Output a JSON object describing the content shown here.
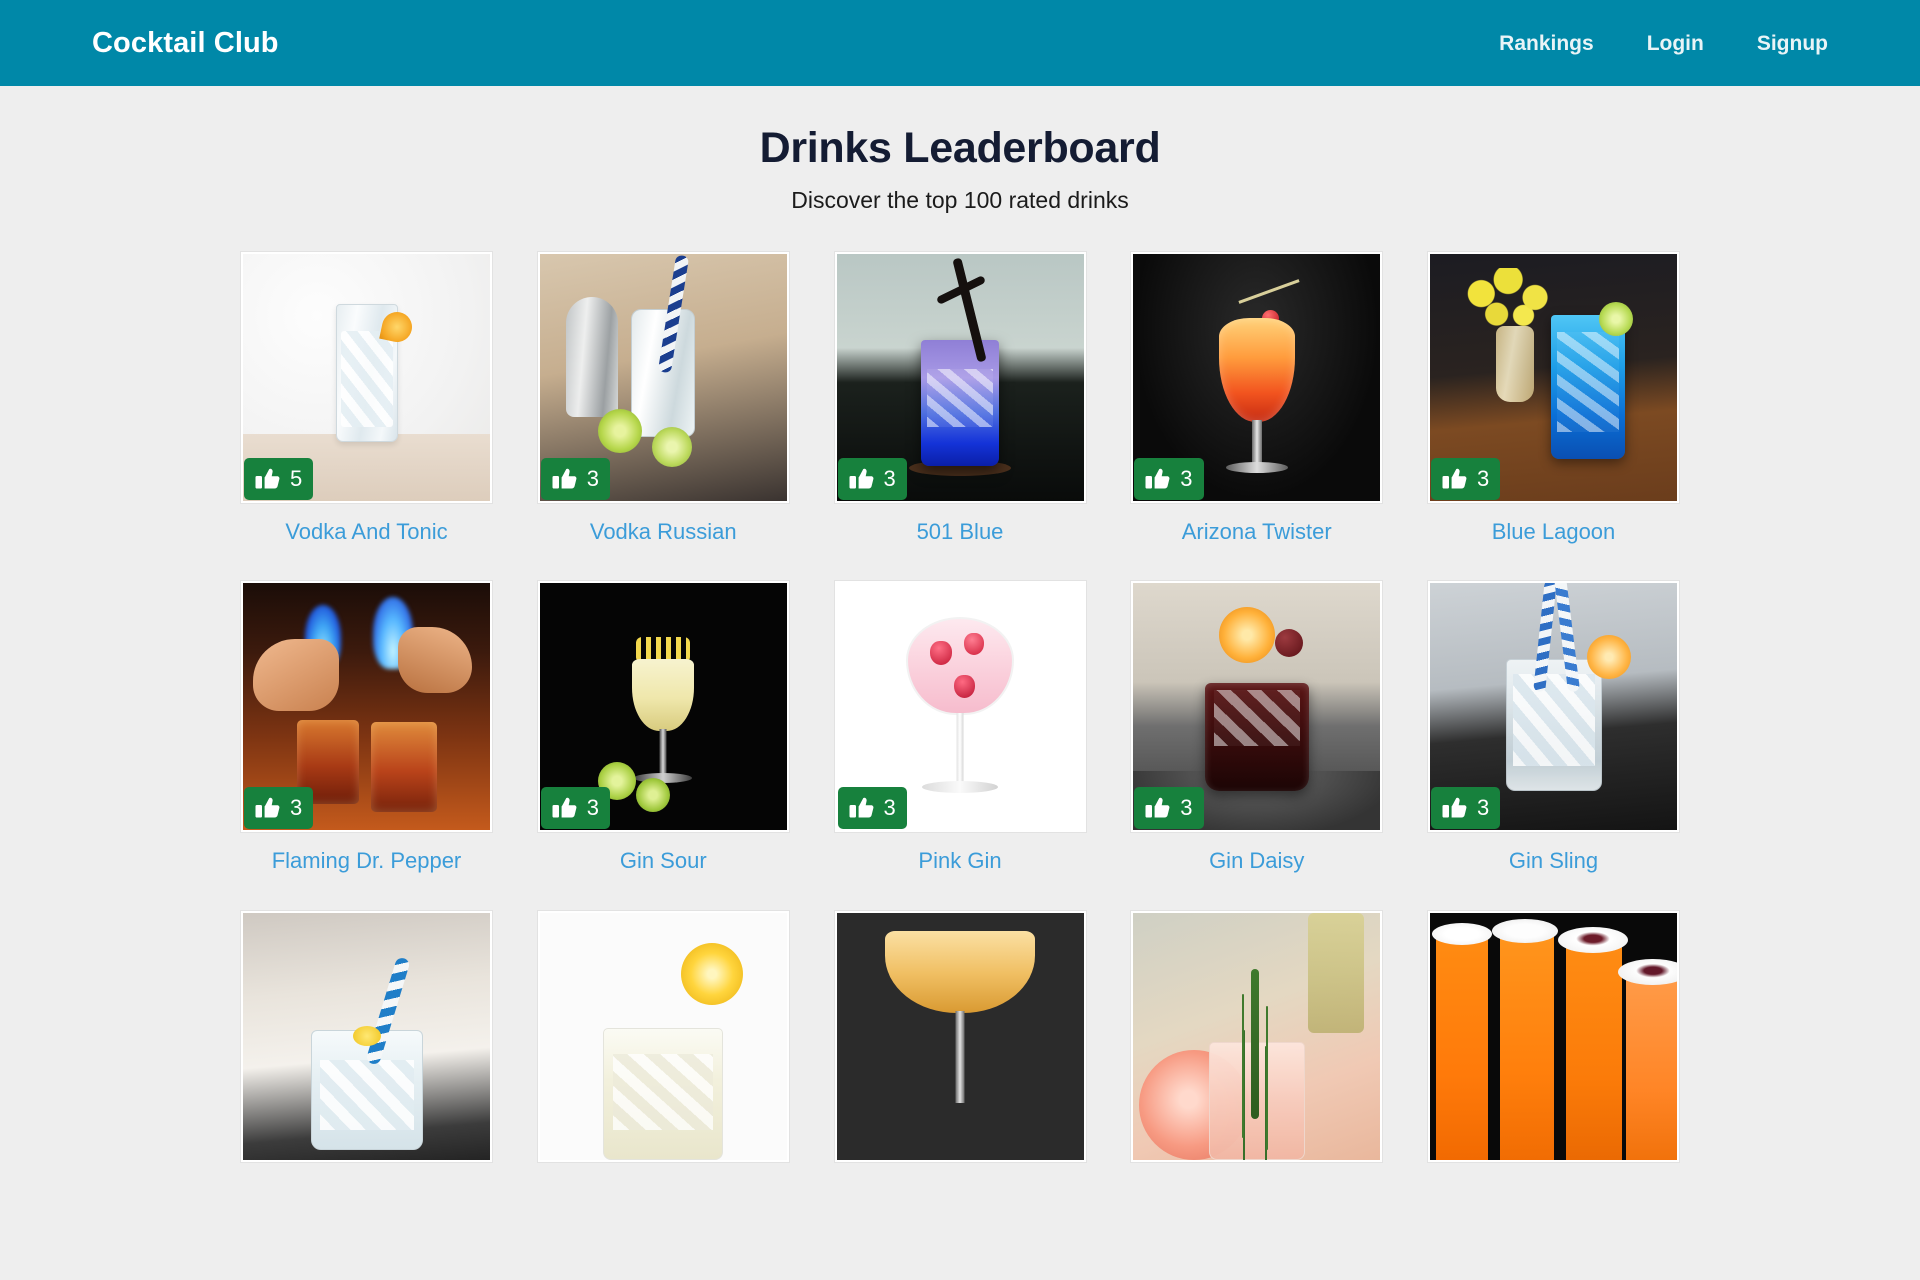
{
  "navbar": {
    "brand": "Cocktail Club",
    "links": [
      {
        "label": "Rankings",
        "name": "nav-link-rankings"
      },
      {
        "label": "Login",
        "name": "nav-link-login"
      },
      {
        "label": "Signup",
        "name": "nav-link-signup"
      }
    ],
    "background_color": "#0088a8"
  },
  "header": {
    "title": "Drinks Leaderboard",
    "subtitle": "Discover the top 100 rated drinks",
    "title_color": "#141c33"
  },
  "theme": {
    "page_background": "#eeeeee",
    "link_color": "#3b9cd9",
    "badge_color": "#17813d",
    "badge_text_color": "#ffffff"
  },
  "leaderboard": {
    "vote_icon": "thumbs-up-icon",
    "drinks": [
      {
        "name": "Vodka And Tonic",
        "votes": "5",
        "art": "img-vodka-tonic"
      },
      {
        "name": "Vodka Russian",
        "votes": "3",
        "art": "img-vodka-russian"
      },
      {
        "name": "501 Blue",
        "votes": "3",
        "art": "img-501-blue"
      },
      {
        "name": "Arizona Twister",
        "votes": "3",
        "art": "img-arizona"
      },
      {
        "name": "Blue Lagoon",
        "votes": "3",
        "art": "img-blue-lagoon"
      },
      {
        "name": "Flaming Dr. Pepper",
        "votes": "3",
        "art": "img-flaming"
      },
      {
        "name": "Gin Sour",
        "votes": "3",
        "art": "img-gin-sour"
      },
      {
        "name": "Pink Gin",
        "votes": "3",
        "art": "img-pink-gin"
      },
      {
        "name": "Gin Daisy",
        "votes": "3",
        "art": "img-gin-daisy"
      },
      {
        "name": "Gin Sling",
        "votes": "3",
        "art": "img-gin-sling"
      },
      {
        "name": "",
        "votes": "",
        "art": "img-r3a"
      },
      {
        "name": "",
        "votes": "",
        "art": "img-r3b"
      },
      {
        "name": "",
        "votes": "",
        "art": "img-r3c"
      },
      {
        "name": "",
        "votes": "",
        "art": "img-r3d"
      },
      {
        "name": "",
        "votes": "",
        "art": "img-r3e"
      }
    ]
  }
}
